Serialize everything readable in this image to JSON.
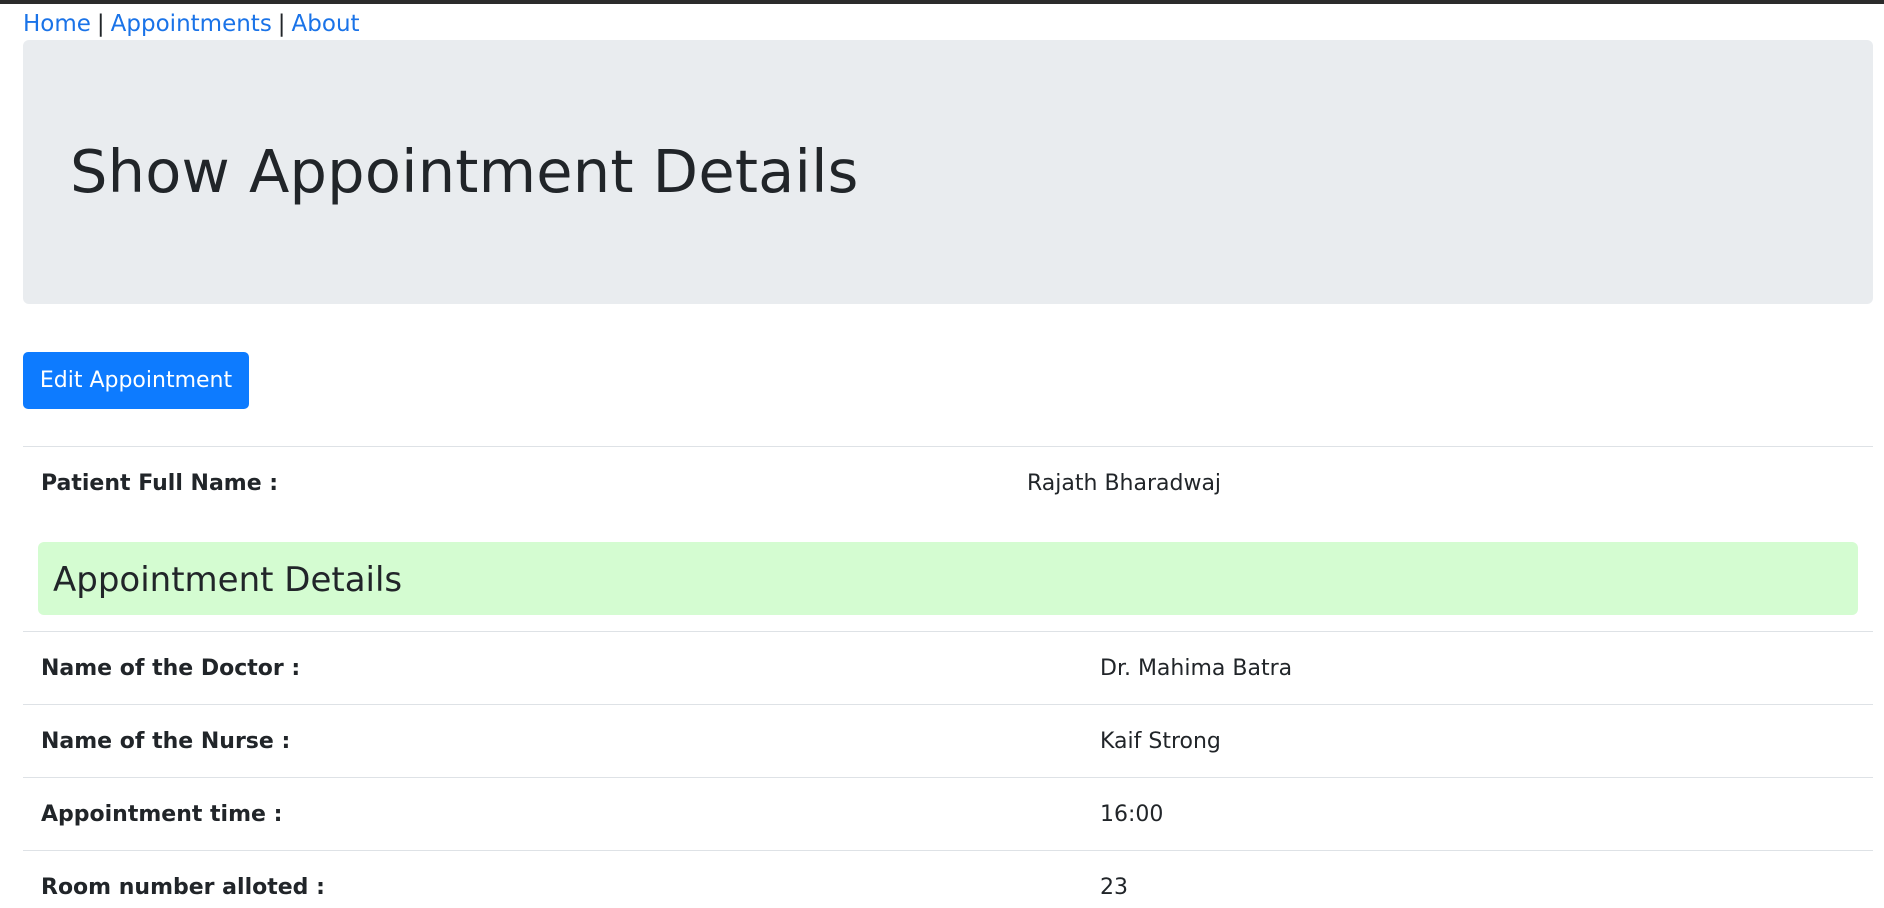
{
  "nav": {
    "home": "Home",
    "appointments": "Appointments",
    "about": "About",
    "separator": "|"
  },
  "header": {
    "title": "Show Appointment Details"
  },
  "actions": {
    "edit_label": "Edit Appointment"
  },
  "patient": {
    "label": "Patient Full Name :",
    "value": "Rajath Bharadwaj"
  },
  "appointment": {
    "heading": "Appointment Details",
    "rows": [
      {
        "label": "Name of the Doctor :",
        "value": "Dr. Mahima Batra"
      },
      {
        "label": "Name of the Nurse :",
        "value": "Kaif Strong"
      },
      {
        "label": "Appointment time :",
        "value": "16:00"
      },
      {
        "label": "Room number alloted :",
        "value": "23"
      }
    ]
  },
  "colors": {
    "link": "#1a73e8",
    "primary_button": "#0d7bff",
    "jumbotron_bg": "#e9ecef",
    "section_heading_bg": "#d4fcd1",
    "text": "#212529"
  }
}
